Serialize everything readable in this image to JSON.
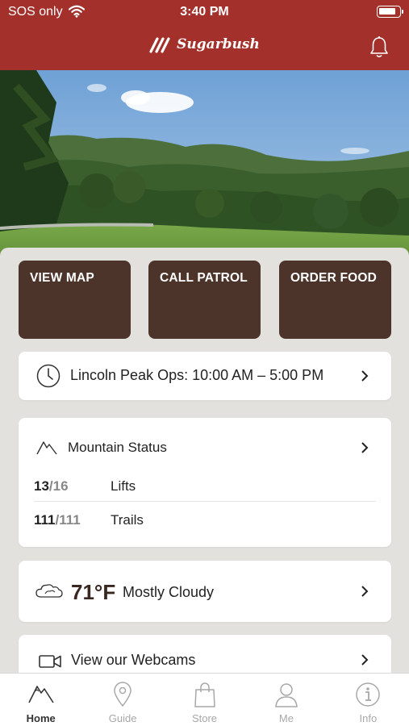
{
  "status_bar": {
    "carrier": "SOS only",
    "time": "3:40 PM"
  },
  "header": {
    "logo_text": "Sugarbush"
  },
  "hero": {
    "description": ""
  },
  "actions": [
    {
      "label": "VIEW MAP"
    },
    {
      "label": "CALL PATROL"
    },
    {
      "label": "ORDER FOOD"
    }
  ],
  "ops": {
    "text": "Lincoln Peak Ops: 10:00 AM – 5:00 PM"
  },
  "mountain_status": {
    "title": "Mountain Status",
    "rows": [
      {
        "open": "13",
        "total": "/16",
        "label": "Lifts"
      },
      {
        "open": "111",
        "total": "/111",
        "label": "Trails"
      }
    ]
  },
  "weather": {
    "temperature": "71°F",
    "condition": "Mostly Cloudy"
  },
  "webcams": {
    "label": "View our Webcams"
  },
  "tabs": [
    {
      "label": "Home",
      "icon": "mountain-icon",
      "active": true
    },
    {
      "label": "Guide",
      "icon": "map-pin-icon",
      "active": false
    },
    {
      "label": "Store",
      "icon": "shopping-bag-icon",
      "active": false
    },
    {
      "label": "Me",
      "icon": "person-icon",
      "active": false
    },
    {
      "label": "Info",
      "icon": "info-icon",
      "active": false
    }
  ],
  "colors": {
    "brand_red": "#a3302b",
    "button_brown": "#4d342b",
    "panel_bg": "#e3e1dd"
  }
}
